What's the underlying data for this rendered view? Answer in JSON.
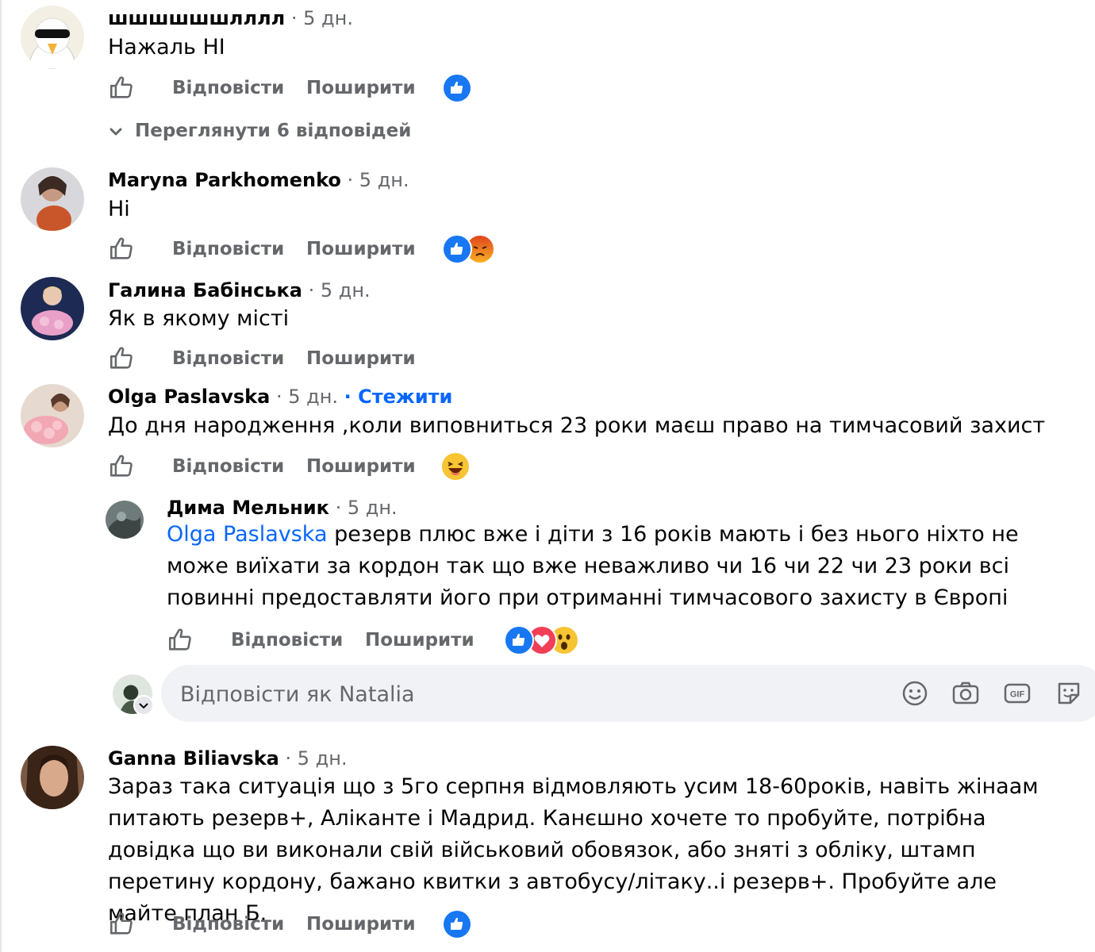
{
  "actions": {
    "reply": "Відповісти",
    "share": "Поширити"
  },
  "comments": [
    {
      "author": "шшшшшшлллл",
      "time": "· 5 дн.",
      "text": "Нажаль НІ"
    },
    {
      "author": "Maryna Parkhomenko",
      "time": "· 5 дн.",
      "text": "Ні"
    },
    {
      "author": "Галина Бабінська",
      "time": "· 5 дн.",
      "text": "Як в якому місті"
    },
    {
      "author": "Olga Paslavska",
      "time": "· 5 дн.",
      "follow": "· Стежити",
      "text": "До дня народження ,коли виповниться 23 роки маєш право на тимчасовий захист"
    },
    {
      "author": "Ganna Biliavska",
      "time": "· 5 дн.",
      "text": "Зараз така ситуація що з 5го серпня відмовляють усим 18-60років, навіть жінаам питають резерв+, Аліканте і Мадрид. Канєшно хочете то пробуйте, потрібна довідка що ви виконали свій військовий обовязок, або зняті з обліку, штамп перетину кордону, бажано квитки з автобусу/літаку..і резерв+. Пробуйте але майте план Б."
    }
  ],
  "view_replies": "Переглянути 6 відповідей",
  "nested_reply": {
    "author": "Дима Мельник",
    "time": "· 5 дн.",
    "mention": "Olga Paslavska",
    "text": " резерв плюс вже і діти з 16 років мають і без нього ніхто не може виїхати за кордон так що вже неважливо чи 16 чи 22 чи 23 роки всі повинні предоставляти його при отриманні тимчасового захисту в Європі"
  },
  "reply_box": {
    "placeholder": "Відповісти як Natalia"
  },
  "reaction_icons": [
    "like-reaction",
    "angry-reaction",
    "haha-reaction",
    "love-reaction",
    "wow-reaction"
  ],
  "colors": {
    "accent": "#0866ff",
    "secondary_text": "#65676b",
    "input_bg": "#f0f2f5"
  }
}
